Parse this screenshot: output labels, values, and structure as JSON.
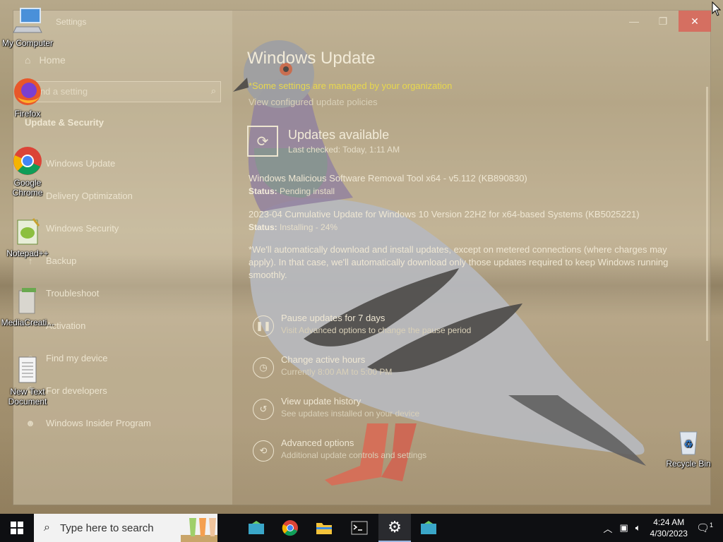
{
  "window": {
    "title": "Settings",
    "home_label": "Home",
    "search_placeholder": "Find a setting",
    "section_label": "Update & Security",
    "nav": [
      {
        "label": "Windows Update",
        "icon": "refresh-icon"
      },
      {
        "label": "Delivery Optimization",
        "icon": "delivery-icon"
      },
      {
        "label": "Windows Security",
        "icon": "shield-icon"
      },
      {
        "label": "Backup",
        "icon": "backup-icon"
      },
      {
        "label": "Troubleshoot",
        "icon": "wrench-icon"
      },
      {
        "label": "Activation",
        "icon": "check-circle-icon"
      },
      {
        "label": "Find my device",
        "icon": "person-icon"
      },
      {
        "label": "For developers",
        "icon": "developer-icon"
      },
      {
        "label": "Windows Insider Program",
        "icon": "insider-icon"
      }
    ]
  },
  "main": {
    "title": "Windows Update",
    "managed_notice": "*Some settings are managed by your organization",
    "policies_link": "View configured update policies",
    "status_title": "Updates available",
    "last_checked": "Last checked: Today, 1:11 AM",
    "updates": [
      {
        "name": "Windows Malicious Software Removal Tool x64 - v5.112 (KB890830)",
        "status_label": "Status:",
        "status_value": "Pending install"
      },
      {
        "name": "2023-04 Cumulative Update for Windows 10 Version 22H2 for x64-based Systems (KB5025221)",
        "status_label": "Status:",
        "status_value": "Installing - 24%"
      }
    ],
    "note": "*We'll automatically download and install updates, except on metered connections (where charges may apply). In that case, we'll automatically download only those updates required to keep Windows running smoothly.",
    "options": [
      {
        "title": "Pause updates for 7 days",
        "subtitle": "Visit Advanced options to change the pause period",
        "icon": "pause-icon"
      },
      {
        "title": "Change active hours",
        "subtitle": "Currently 8:00 AM to 5:00 PM",
        "icon": "clock-icon"
      },
      {
        "title": "View update history",
        "subtitle": "See updates installed on your device",
        "icon": "history-icon"
      },
      {
        "title": "Advanced options",
        "subtitle": "Additional update controls and settings",
        "icon": "gear-refresh-icon"
      }
    ]
  },
  "desktop_icons": [
    {
      "label": "My Computer",
      "icon": "computer-icon"
    },
    {
      "label": "Firefox",
      "icon": "firefox-icon"
    },
    {
      "label": "Google Chrome",
      "icon": "chrome-icon"
    },
    {
      "label": "Notepad++",
      "icon": "notepadpp-icon"
    },
    {
      "label": "MediaCreati...",
      "icon": "media-creation-icon"
    },
    {
      "label": "New Text Document",
      "icon": "text-document-icon"
    },
    {
      "label": "Recycle Bin",
      "icon": "recycle-bin-icon"
    }
  ],
  "taskbar": {
    "search_placeholder": "Type here to search",
    "apps": [
      "media-creation-tool-icon",
      "chrome-icon",
      "file-explorer-icon",
      "terminal-icon",
      "settings-gear-icon",
      "media-creation-tool-icon"
    ],
    "time": "4:24 AM",
    "date": "4/30/2023",
    "notification_count": "1"
  },
  "colors": {
    "notice_yellow": "#e8d84d",
    "taskbar_bg": "#0e0f12",
    "close_red": "#dc5a50"
  }
}
